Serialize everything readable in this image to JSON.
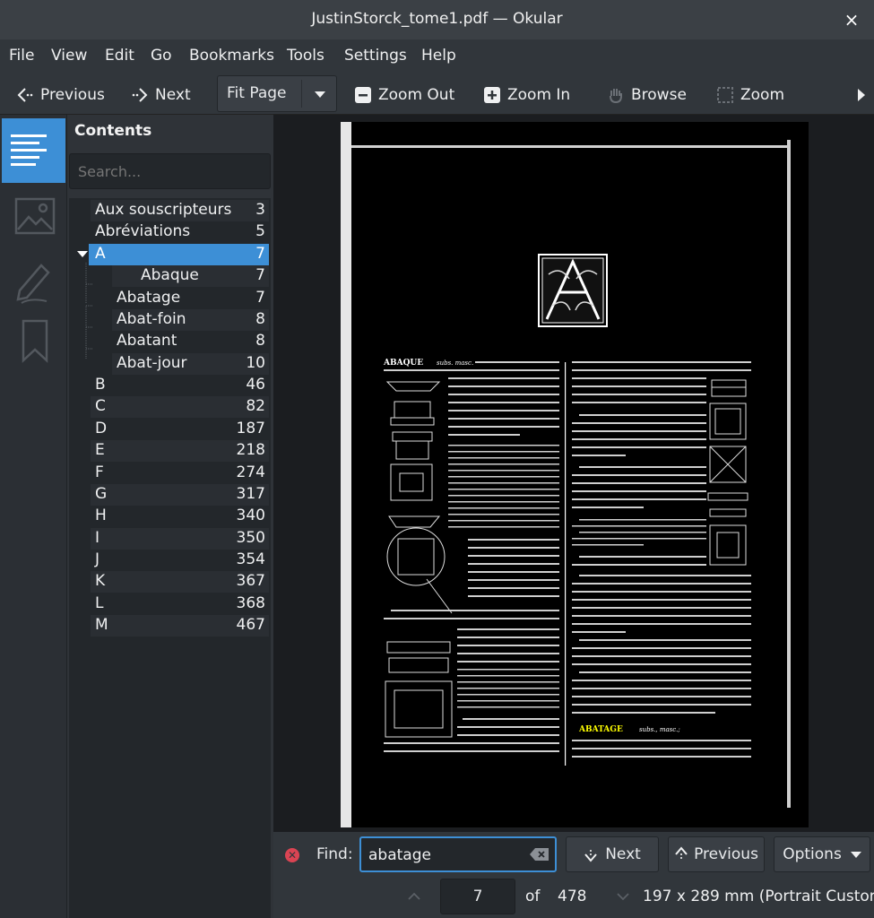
{
  "window": {
    "title": "JustinStorck_tome1.pdf — Okular",
    "close_glyph": "×"
  },
  "menu": [
    "File",
    "View",
    "Edit",
    "Go",
    "Bookmarks",
    "Tools",
    "Settings",
    "Help"
  ],
  "toolbar": {
    "previous": "Previous",
    "next": "Next",
    "zoom_mode": "Fit Page",
    "zoom_out": "Zoom Out",
    "zoom_in": "Zoom In",
    "browse": "Browse",
    "zoom": "Zoom"
  },
  "sidebar": {
    "header": "Contents",
    "search_placeholder": "Search...",
    "items": [
      {
        "label": "Aux souscripteurs",
        "page": "3"
      },
      {
        "label": "Abréviations",
        "page": "5"
      },
      {
        "label": "A",
        "page": "7",
        "selected": true
      },
      {
        "label": "Abaque",
        "page": "7"
      },
      {
        "label": "Abatage",
        "page": "7"
      },
      {
        "label": "Abat-foin",
        "page": "8"
      },
      {
        "label": "Abatant",
        "page": "8"
      },
      {
        "label": "Abat-jour",
        "page": "10"
      },
      {
        "label": "B",
        "page": "46"
      },
      {
        "label": "C",
        "page": "82"
      },
      {
        "label": "D",
        "page": "187"
      },
      {
        "label": "E",
        "page": "218"
      },
      {
        "label": "F",
        "page": "274"
      },
      {
        "label": "G",
        "page": "317"
      },
      {
        "label": "H",
        "page": "340"
      },
      {
        "label": "I",
        "page": "350"
      },
      {
        "label": "J",
        "page": "354"
      },
      {
        "label": "K",
        "page": "367"
      },
      {
        "label": "L",
        "page": "368"
      },
      {
        "label": "M",
        "page": "467"
      }
    ]
  },
  "document": {
    "left_col_head": "ABAQUE",
    "left_col_sub": "subs. masc.",
    "right_col_head": "ABATAGE",
    "right_col_sub": "subs., masc.;"
  },
  "findbar": {
    "label": "Find:",
    "query": "abatage",
    "next": "Next",
    "previous": "Previous",
    "options": "Options"
  },
  "status": {
    "current_page": "7",
    "of_label": "of",
    "total_pages": "478",
    "page_size": "197 x 289 mm (Portrait Custom)"
  },
  "colors": {
    "accent": "#3d8fd6",
    "highlight": "#ffff00"
  }
}
